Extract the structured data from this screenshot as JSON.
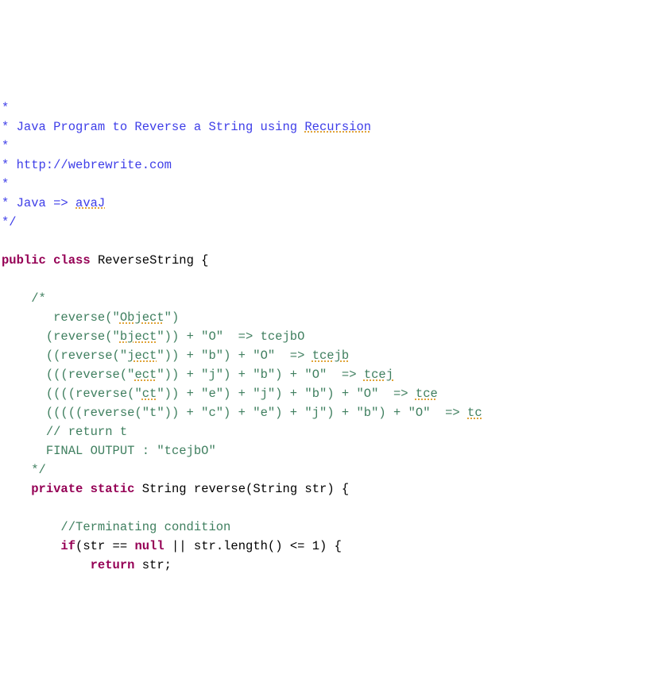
{
  "h": {
    "l1": "*",
    "l2a": "* Java Program to Reverse a String using ",
    "l2b": "Recursion",
    "l3": "*",
    "l4": "* http://webrewrite.com",
    "l5": "*",
    "l6a": "* Java => ",
    "l6b": "avaJ",
    "l7": "*/"
  },
  "kw": {
    "public": "public",
    "class": "class",
    "private": "private",
    "static": "static",
    "return": "return",
    "if": "if",
    "null": "null"
  },
  "id": {
    "ReverseString": "ReverseString",
    "String": "String",
    "reverse": "reverse",
    "str": "str",
    "length": "length"
  },
  "cm": {
    "open": "/*",
    "close": "*/",
    "l1a": "   reverse(\"",
    "l1b": "Object",
    "l1c": "\")",
    "l2a": "  (reverse(\"",
    "l2b": "bject",
    "l2c": "\")) + \"O\"  => tcejbO",
    "l3a": "  ((reverse(\"",
    "l3b": "ject",
    "l3c": "\")) + \"b\") + \"O\"  => ",
    "l3d": "tcejb",
    "l4a": "  (((reverse(\"",
    "l4b": "ect",
    "l4c": "\")) + \"j\") + \"b\") + \"O\"  => ",
    "l4d": "tcej",
    "l5a": "  ((((reverse(\"",
    "l5b": "ct",
    "l5c": "\")) + \"e\") + \"j\") + \"b\") + \"O\"  => ",
    "l5d": "tce",
    "l6a": "  (((((reverse(\"t\")) + \"c\") + \"e\") + \"j\") + \"b\") + \"O\"  => ",
    "l6b": "tc",
    "l7": "  // return t",
    "l8": "  FINAL OUTPUT : \"tcejbO\"",
    "term": "//Terminating condition"
  },
  "sym": {
    "obrace": " {",
    "cbrace": "}",
    "semi": ";",
    "paren_sig_open": " reverse(",
    "paren_sig_close": " str) {",
    "eqeq": " == ",
    "or": " || ",
    "leq": " <= 1) {",
    "dot_len": ".length()",
    "if_open": "(",
    "sp_return": " str;"
  }
}
